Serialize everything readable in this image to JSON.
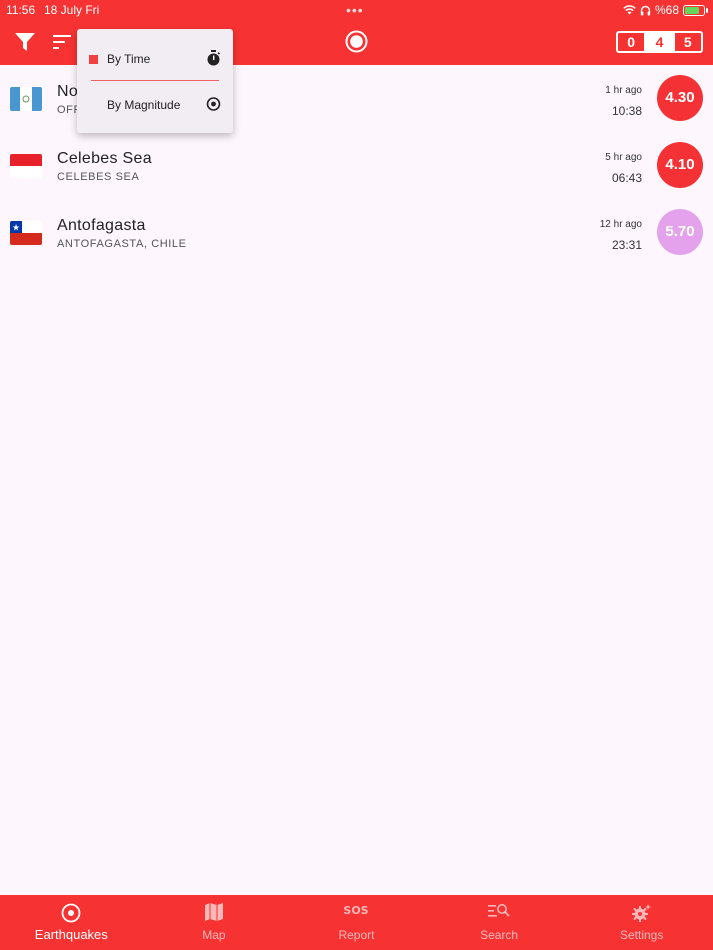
{
  "status_bar": {
    "time": "11:56",
    "date": "18 July Fri",
    "battery": "%68"
  },
  "app_bar": {
    "magnitude_filter": [
      {
        "label": "0",
        "active": false
      },
      {
        "label": "4",
        "active": true
      },
      {
        "label": "5",
        "active": false
      }
    ]
  },
  "sort_menu": {
    "items": [
      {
        "label": "By Time",
        "selected": true,
        "icon": "stopwatch-icon"
      },
      {
        "label": "By Magnitude",
        "selected": false,
        "icon": "radio-target-icon"
      }
    ]
  },
  "earthquakes": [
    {
      "title": "No",
      "subtitle": "OFF",
      "ago": "1 hr ago",
      "time": "10:38",
      "magnitude": "4.30",
      "color": "#f43236",
      "flag": "guatemala"
    },
    {
      "title": "Celebes Sea",
      "subtitle": "CELEBES SEA",
      "ago": "5 hr ago",
      "time": "06:43",
      "magnitude": "4.10",
      "color": "#f43236",
      "flag": "indonesia"
    },
    {
      "title": "Antofagasta",
      "subtitle": "ANTOFAGASTA, CHILE",
      "ago": "12 hr ago",
      "time": "23:31",
      "magnitude": "5.70",
      "color": "#e4a2ec",
      "flag": "chile"
    }
  ],
  "bottom_nav": [
    {
      "label": "Earthquakes",
      "active": true
    },
    {
      "label": "Map",
      "active": false
    },
    {
      "label": "Report",
      "active": false
    },
    {
      "label": "Search",
      "active": false
    },
    {
      "label": "Settings",
      "active": false
    }
  ],
  "colors": {
    "primary": "#f73232",
    "background": "#fdf6fd"
  }
}
